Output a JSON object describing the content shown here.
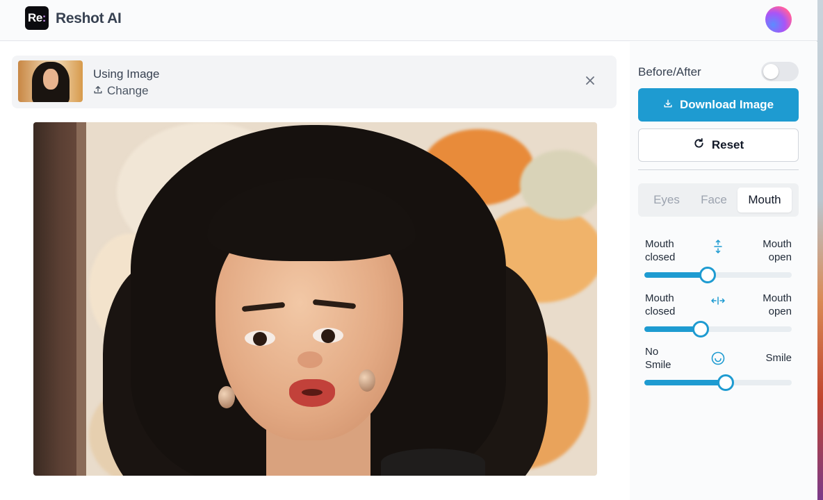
{
  "header": {
    "logo_text": "Re",
    "logo_colon": ":",
    "brand": "Reshot AI"
  },
  "file_bar": {
    "using_label": "Using Image",
    "change_label": "Change"
  },
  "sidebar": {
    "before_after_label": "Before/After",
    "before_after_on": false,
    "download_label": "Download Image",
    "reset_label": "Reset",
    "tabs": [
      {
        "label": "Eyes",
        "active": false
      },
      {
        "label": "Face",
        "active": false
      },
      {
        "label": "Mouth",
        "active": true
      }
    ],
    "sliders": [
      {
        "left_line1": "Mouth",
        "left_line2": "closed",
        "right_line1": "Mouth",
        "right_line2": "open",
        "icon": "vertical-arrows-icon",
        "value": 0.43
      },
      {
        "left_line1": "Mouth",
        "left_line2": "closed",
        "right_line1": "Mouth",
        "right_line2": "open",
        "icon": "horizontal-arrows-icon",
        "value": 0.38
      },
      {
        "left_line1": "No",
        "left_line2": "Smile",
        "right_line1": "Smile",
        "right_line2": "",
        "icon": "smile-icon",
        "value": 0.55
      }
    ]
  },
  "colors": {
    "accent": "#1e9bd1",
    "brand_text": "#374151"
  }
}
